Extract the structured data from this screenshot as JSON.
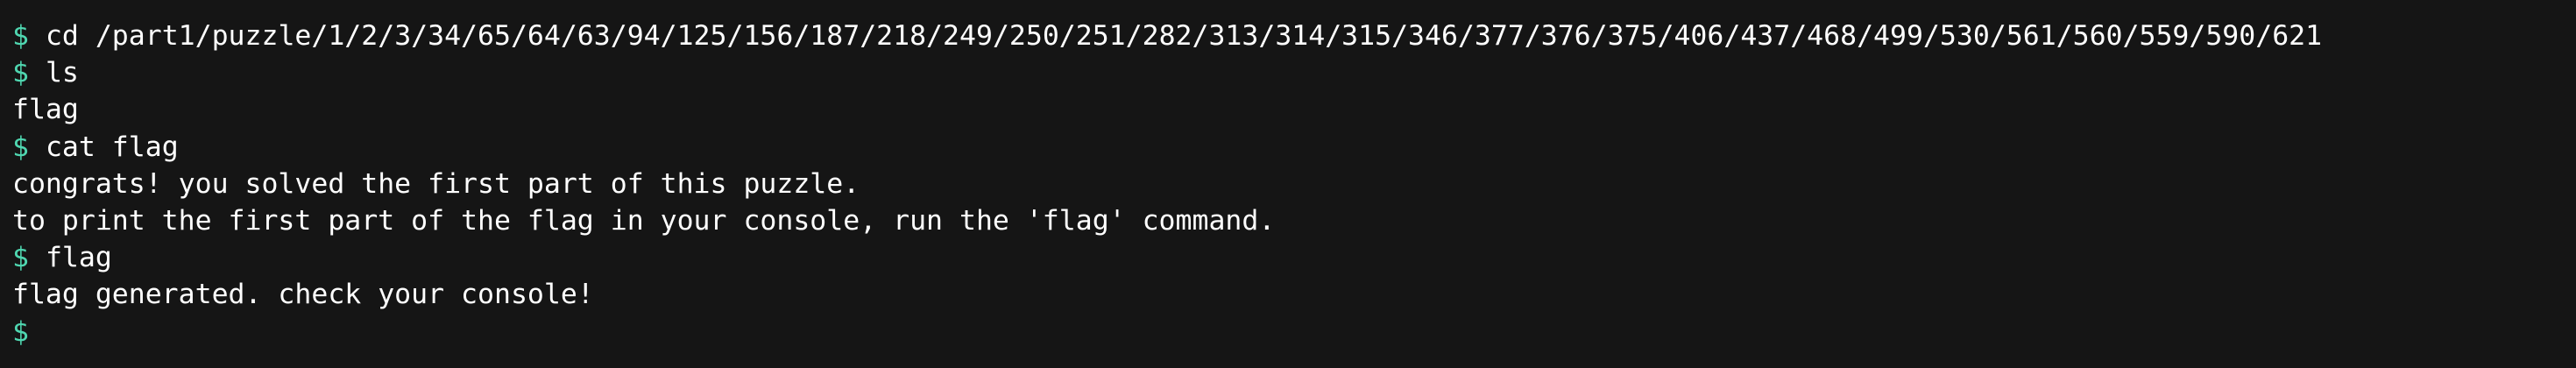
{
  "terminal": {
    "prompt_symbol": "$",
    "prompt_color": "#4fd6b0",
    "text_color": "#ffffff",
    "background_color": "#151515",
    "lines": [
      {
        "type": "command",
        "text": "cd /part1/puzzle/1/2/3/34/65/64/63/94/125/156/187/218/249/250/251/282/313/314/315/346/377/376/375/406/437/468/499/530/561/560/559/590/621"
      },
      {
        "type": "command",
        "text": "ls"
      },
      {
        "type": "output",
        "text": "flag"
      },
      {
        "type": "command",
        "text": "cat flag"
      },
      {
        "type": "output",
        "text": "congrats! you solved the first part of this puzzle."
      },
      {
        "type": "output",
        "text": "to print the first part of the flag in your console, run the 'flag' command."
      },
      {
        "type": "command",
        "text": "flag"
      },
      {
        "type": "output",
        "text": "flag generated. check your console!"
      },
      {
        "type": "command",
        "text": ""
      }
    ]
  }
}
